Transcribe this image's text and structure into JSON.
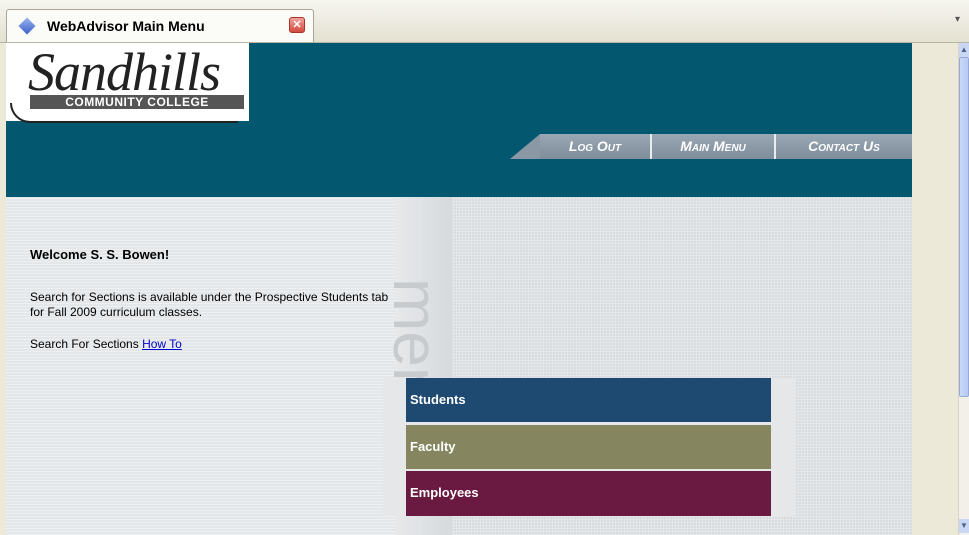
{
  "browser": {
    "tab_title": "WebAdvisor Main Menu",
    "tab_close": "✕",
    "scroll_up": "▲",
    "scroll_down": "▼"
  },
  "logo": {
    "name": "Sandhills",
    "sub": "COMMUNITY COLLEGE"
  },
  "nav": {
    "items": [
      "Log Out",
      "Main Menu",
      "Contact Us"
    ]
  },
  "watermark": "menu",
  "welcome": "Welcome S. S. Bowen!",
  "notice": "Search for Sections is available under the Prospective Students tab for Fall 2009 curriculum classes.",
  "search_prefix": "Search For Sections",
  "how_to": "How To",
  "menu": {
    "items": [
      "Students",
      "Faculty",
      "Employees"
    ],
    "colors": [
      "#1e4a72",
      "#858660",
      "#6a1a40"
    ]
  },
  "colors": {
    "header": "#03576f",
    "nav": "#8a98a6"
  }
}
